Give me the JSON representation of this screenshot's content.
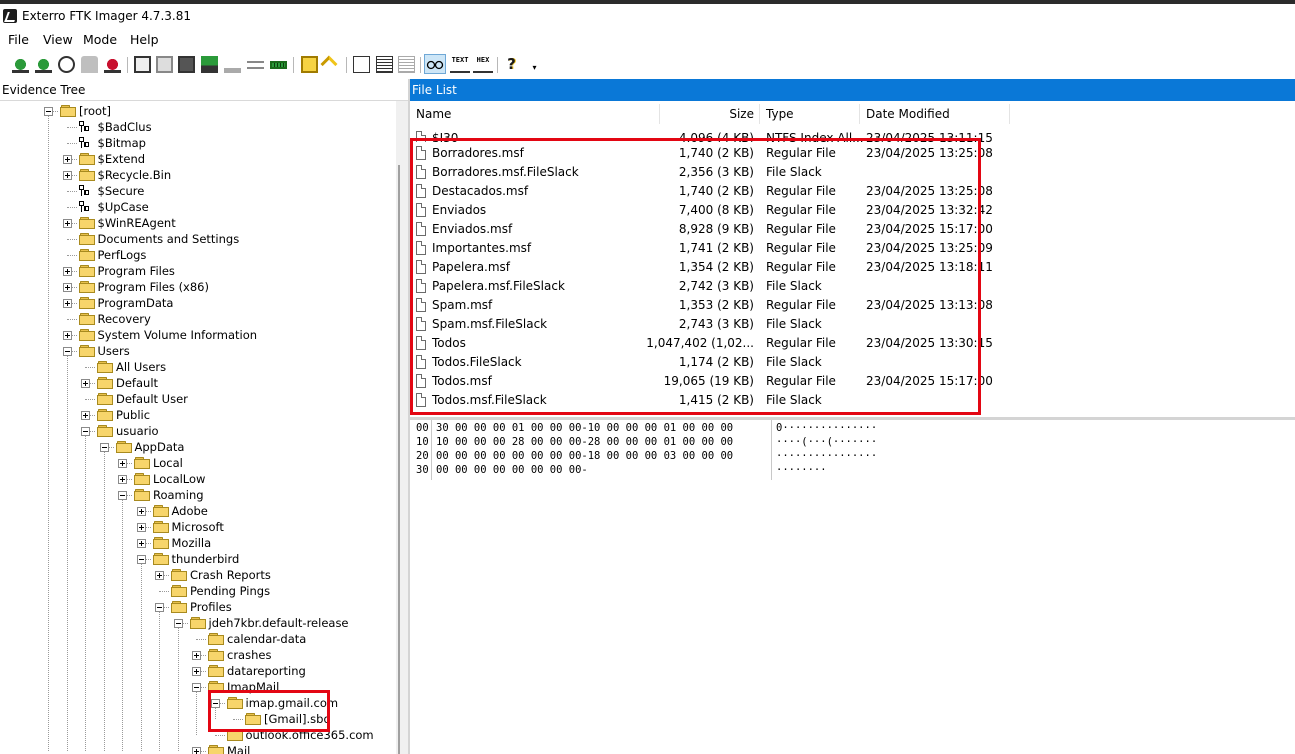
{
  "window": {
    "title": "Exterro FTK Imager 4.7.3.81"
  },
  "menu": [
    "File",
    "View",
    "Mode",
    "Help"
  ],
  "toolbar_icons": [
    "add-evidence-icon",
    "add-all-evidence-icon",
    "image-mounting-icon",
    "remove-evidence-icon",
    "remove-all-evidence-icon",
    "create-disk-image-icon",
    "export-disk-image-icon",
    "capture-memory-icon",
    "obtain-protected-files-icon",
    "detect-encryption-icon",
    "verify-drive-icon",
    "ram-icon",
    "export-files-icon",
    "export-hash-list-icon",
    "new-document-icon",
    "view-files-icon",
    "view-properties-icon",
    "automatic-view-icon",
    "text-view-icon",
    "hex-view-icon",
    "help-icon",
    "dropdown-icon"
  ],
  "evidence_tree": {
    "header": "Evidence Tree",
    "nodes": [
      {
        "label": "[root]",
        "depth": 0,
        "toggle": "minus",
        "icon": "folder"
      },
      {
        "label": "$BadClus",
        "depth": 1,
        "toggle": "none",
        "icon": "sys"
      },
      {
        "label": "$Bitmap",
        "depth": 1,
        "toggle": "none",
        "icon": "sys"
      },
      {
        "label": "$Extend",
        "depth": 1,
        "toggle": "plus",
        "icon": "folder"
      },
      {
        "label": "$Recycle.Bin",
        "depth": 1,
        "toggle": "plus",
        "icon": "folder"
      },
      {
        "label": "$Secure",
        "depth": 1,
        "toggle": "none",
        "icon": "sys"
      },
      {
        "label": "$UpCase",
        "depth": 1,
        "toggle": "none",
        "icon": "sys"
      },
      {
        "label": "$WinREAgent",
        "depth": 1,
        "toggle": "plus",
        "icon": "folder"
      },
      {
        "label": "Documents and Settings",
        "depth": 1,
        "toggle": "none",
        "icon": "folder"
      },
      {
        "label": "PerfLogs",
        "depth": 1,
        "toggle": "none",
        "icon": "folder"
      },
      {
        "label": "Program Files",
        "depth": 1,
        "toggle": "plus",
        "icon": "folder"
      },
      {
        "label": "Program Files (x86)",
        "depth": 1,
        "toggle": "plus",
        "icon": "folder"
      },
      {
        "label": "ProgramData",
        "depth": 1,
        "toggle": "plus",
        "icon": "folder"
      },
      {
        "label": "Recovery",
        "depth": 1,
        "toggle": "none",
        "icon": "folder"
      },
      {
        "label": "System Volume Information",
        "depth": 1,
        "toggle": "plus",
        "icon": "folder"
      },
      {
        "label": "Users",
        "depth": 1,
        "toggle": "minus",
        "icon": "folder"
      },
      {
        "label": "All Users",
        "depth": 2,
        "toggle": "none",
        "icon": "folder"
      },
      {
        "label": "Default",
        "depth": 2,
        "toggle": "plus",
        "icon": "folder"
      },
      {
        "label": "Default User",
        "depth": 2,
        "toggle": "none",
        "icon": "folder"
      },
      {
        "label": "Public",
        "depth": 2,
        "toggle": "plus",
        "icon": "folder"
      },
      {
        "label": "usuario",
        "depth": 2,
        "toggle": "minus",
        "icon": "folder"
      },
      {
        "label": "AppData",
        "depth": 3,
        "toggle": "minus",
        "icon": "folder"
      },
      {
        "label": "Local",
        "depth": 4,
        "toggle": "plus",
        "icon": "folder"
      },
      {
        "label": "LocalLow",
        "depth": 4,
        "toggle": "plus",
        "icon": "folder"
      },
      {
        "label": "Roaming",
        "depth": 4,
        "toggle": "minus",
        "icon": "folder"
      },
      {
        "label": "Adobe",
        "depth": 5,
        "toggle": "plus",
        "icon": "folder"
      },
      {
        "label": "Microsoft",
        "depth": 5,
        "toggle": "plus",
        "icon": "folder"
      },
      {
        "label": "Mozilla",
        "depth": 5,
        "toggle": "plus",
        "icon": "folder"
      },
      {
        "label": "thunderbird",
        "depth": 5,
        "toggle": "minus",
        "icon": "folder"
      },
      {
        "label": "Crash Reports",
        "depth": 6,
        "toggle": "plus",
        "icon": "folder"
      },
      {
        "label": "Pending Pings",
        "depth": 6,
        "toggle": "none",
        "icon": "folder"
      },
      {
        "label": "Profiles",
        "depth": 6,
        "toggle": "minus",
        "icon": "folder"
      },
      {
        "label": "jdeh7kbr.default-release",
        "depth": 7,
        "toggle": "minus",
        "icon": "folder"
      },
      {
        "label": "calendar-data",
        "depth": 8,
        "toggle": "none",
        "icon": "folder"
      },
      {
        "label": "crashes",
        "depth": 8,
        "toggle": "plus",
        "icon": "folder"
      },
      {
        "label": "datareporting",
        "depth": 8,
        "toggle": "plus",
        "icon": "folder"
      },
      {
        "label": "ImapMail",
        "depth": 8,
        "toggle": "minus",
        "icon": "folder"
      },
      {
        "label": "imap.gmail.com",
        "depth": 9,
        "toggle": "minus",
        "icon": "folder"
      },
      {
        "label": "[Gmail].sbd",
        "depth": 10,
        "toggle": "none",
        "icon": "folder"
      },
      {
        "label": "outlook.office365.com",
        "depth": 9,
        "toggle": "none",
        "icon": "folder"
      },
      {
        "label": "Mail",
        "depth": 8,
        "toggle": "plus",
        "icon": "folder"
      }
    ]
  },
  "file_list": {
    "header": "File List",
    "columns": [
      "Name",
      "Size",
      "Type",
      "Date Modified"
    ],
    "rows": [
      {
        "name": "$I30",
        "size": "4,096 (4 KB)",
        "type": "NTFS Index All...",
        "date": "23/04/2025 13:11:15"
      },
      {
        "name": "Borradores.msf",
        "size": "1,740 (2 KB)",
        "type": "Regular File",
        "date": "23/04/2025 13:25:08"
      },
      {
        "name": "Borradores.msf.FileSlack",
        "size": "2,356 (3 KB)",
        "type": "File Slack",
        "date": ""
      },
      {
        "name": "Destacados.msf",
        "size": "1,740 (2 KB)",
        "type": "Regular File",
        "date": "23/04/2025 13:25:08"
      },
      {
        "name": "Enviados",
        "size": "7,400 (8 KB)",
        "type": "Regular File",
        "date": "23/04/2025 13:32:42"
      },
      {
        "name": "Enviados.msf",
        "size": "8,928 (9 KB)",
        "type": "Regular File",
        "date": "23/04/2025 15:17:00"
      },
      {
        "name": "Importantes.msf",
        "size": "1,741 (2 KB)",
        "type": "Regular File",
        "date": "23/04/2025 13:25:09"
      },
      {
        "name": "Papelera.msf",
        "size": "1,354 (2 KB)",
        "type": "Regular File",
        "date": "23/04/2025 13:18:11"
      },
      {
        "name": "Papelera.msf.FileSlack",
        "size": "2,742 (3 KB)",
        "type": "File Slack",
        "date": ""
      },
      {
        "name": "Spam.msf",
        "size": "1,353 (2 KB)",
        "type": "Regular File",
        "date": "23/04/2025 13:13:08"
      },
      {
        "name": "Spam.msf.FileSlack",
        "size": "2,743 (3 KB)",
        "type": "File Slack",
        "date": ""
      },
      {
        "name": "Todos",
        "size": "1,047,402 (1,02...",
        "type": "Regular File",
        "date": "23/04/2025 13:30:15"
      },
      {
        "name": "Todos.FileSlack",
        "size": "1,174 (2 KB)",
        "type": "File Slack",
        "date": ""
      },
      {
        "name": "Todos.msf",
        "size": "19,065 (19 KB)",
        "type": "Regular File",
        "date": "23/04/2025 15:17:00"
      },
      {
        "name": "Todos.msf.FileSlack",
        "size": "1,415 (2 KB)",
        "type": "File Slack",
        "date": ""
      }
    ]
  },
  "hex_view": {
    "rows": [
      {
        "offset": "00",
        "bytes": "30 00 00 00 01 00 00 00-10 00 00 00 01 00 00 00",
        "ascii": "0···············"
      },
      {
        "offset": "10",
        "bytes": "10 00 00 00 28 00 00 00-28 00 00 00 01 00 00 00",
        "ascii": "····(···(·······"
      },
      {
        "offset": "20",
        "bytes": "00 00 00 00 00 00 00 00-18 00 00 00 03 00 00 00",
        "ascii": "················"
      },
      {
        "offset": "30",
        "bytes": "00 00 00 00 00 00 00 00-",
        "ascii": "········"
      }
    ]
  },
  "colors": {
    "accent": "#0a78d7",
    "highlight_box": "#e30613",
    "folder": "#f7d56b"
  }
}
